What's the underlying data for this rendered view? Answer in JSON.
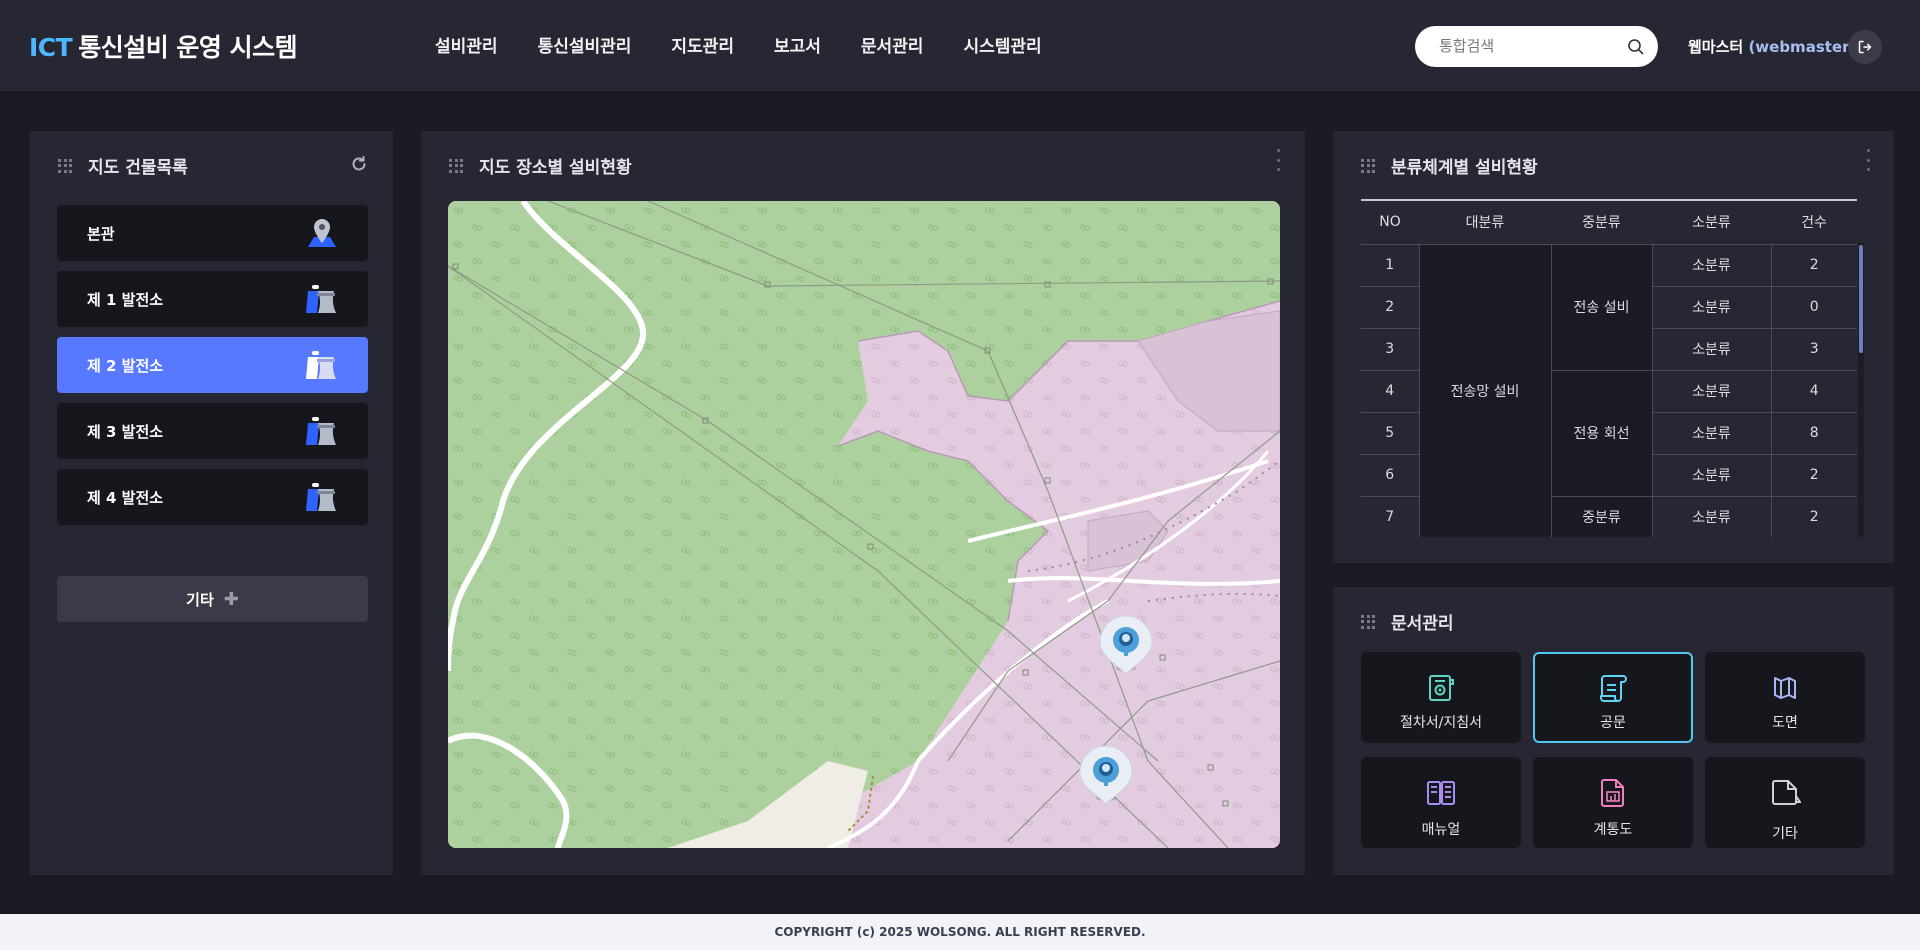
{
  "header": {
    "logo_accent": "ICT",
    "logo_text": "통신설비 운영 시스템",
    "nav": [
      "설비관리",
      "통신설비관리",
      "지도관리",
      "보고서",
      "문서관리",
      "시스템관리"
    ],
    "search_placeholder": "통합검색",
    "user_name": "웹마스터",
    "user_id": "(webmaster)"
  },
  "buildings": {
    "title": "지도 건물목록",
    "items": [
      {
        "label": "본관",
        "icon": "map-pin-icon"
      },
      {
        "label": "제 1 발전소",
        "icon": "power-plant-icon"
      },
      {
        "label": "제 2 발전소",
        "icon": "power-plant-icon"
      },
      {
        "label": "제 3 발전소",
        "icon": "power-plant-icon"
      },
      {
        "label": "제 4 발전소",
        "icon": "power-plant-icon"
      }
    ],
    "active_index": 2,
    "etc_label": "기타"
  },
  "map": {
    "title": "지도 장소별 설비현황"
  },
  "classification": {
    "title": "분류체계별 설비현황",
    "headers": [
      "NO",
      "대분류",
      "중분류",
      "소분류",
      "건수"
    ],
    "major": "전송망 설비",
    "mid": [
      "전송 설비",
      "전용 회선",
      "중분류"
    ],
    "rows": [
      {
        "no": "1",
        "minor": "소분류",
        "count": "2"
      },
      {
        "no": "2",
        "minor": "소분류",
        "count": "0"
      },
      {
        "no": "3",
        "minor": "소분류",
        "count": "3"
      },
      {
        "no": "4",
        "minor": "소분류",
        "count": "4"
      },
      {
        "no": "5",
        "minor": "소분류",
        "count": "8"
      },
      {
        "no": "6",
        "minor": "소분류",
        "count": "2"
      },
      {
        "no": "7",
        "minor": "소분류",
        "count": "2"
      }
    ]
  },
  "documents": {
    "title": "문서관리",
    "items": [
      {
        "label": "절차서/지침서",
        "icon": "procedure-icon"
      },
      {
        "label": "공문",
        "icon": "official-letter-icon"
      },
      {
        "label": "도면",
        "icon": "drawing-icon"
      },
      {
        "label": "매뉴얼",
        "icon": "manual-icon"
      },
      {
        "label": "계통도",
        "icon": "system-diagram-icon"
      },
      {
        "label": "기타",
        "icon": "other-document-icon"
      }
    ],
    "active_index": 1
  },
  "colors": {
    "accent_blue": "#5779ff",
    "logo_accent": "#4cb6ff",
    "active_border": "#53c6f2",
    "panel_bg": "#272733",
    "page_bg": "#1b1b24"
  },
  "footer": {
    "copyright": "COPYRIGHT (c) 2025 WOLSONG. ALL RIGHT RESERVED."
  }
}
